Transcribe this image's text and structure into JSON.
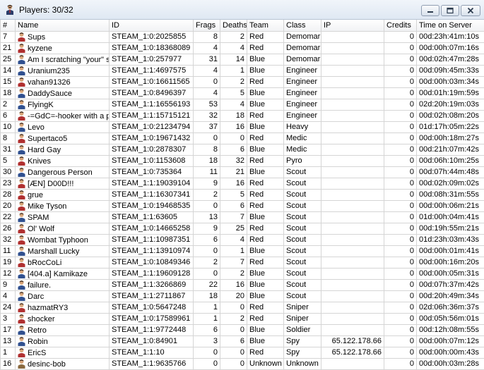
{
  "window": {
    "title": "Players: 30/32"
  },
  "columns": [
    "#",
    "Name",
    "ID",
    "Frags",
    "Deaths",
    "Team",
    "Class",
    "IP",
    "Credits",
    "Time on Server"
  ],
  "rows": [
    {
      "num": "7",
      "name": "Sups",
      "id": "STEAM_1:0:2025855",
      "frags": "8",
      "deaths": "2",
      "team": "Red",
      "class": "Demomar",
      "ip": "",
      "credits": "0",
      "time": "00d:23h:41m:10s"
    },
    {
      "num": "21",
      "name": "kyzene",
      "id": "STEAM_1:0:18368089",
      "frags": "4",
      "deaths": "4",
      "team": "Red",
      "class": "Demomar",
      "ip": "",
      "credits": "0",
      "time": "00d:00h:07m:16s"
    },
    {
      "num": "25",
      "name": "Am I scratching \"your\" s",
      "id": "STEAM_1:0:257977",
      "frags": "31",
      "deaths": "14",
      "team": "Blue",
      "class": "Demomar",
      "ip": "",
      "credits": "0",
      "time": "00d:02h:47m:28s"
    },
    {
      "num": "14",
      "name": "Uranium235",
      "id": "STEAM_1:1:4697575",
      "frags": "4",
      "deaths": "1",
      "team": "Blue",
      "class": "Engineer",
      "ip": "",
      "credits": "0",
      "time": "00d:09h:45m:33s"
    },
    {
      "num": "15",
      "name": "vahan91326",
      "id": "STEAM_1:0:16611565",
      "frags": "0",
      "deaths": "2",
      "team": "Red",
      "class": "Engineer",
      "ip": "",
      "credits": "0",
      "time": "00d:00h:03m:34s"
    },
    {
      "num": "18",
      "name": "DaddySauce",
      "id": "STEAM_1:0:8496397",
      "frags": "4",
      "deaths": "5",
      "team": "Blue",
      "class": "Engineer",
      "ip": "",
      "credits": "0",
      "time": "00d:01h:19m:59s"
    },
    {
      "num": "2",
      "name": "FlyingK",
      "id": "STEAM_1:1:16556193",
      "frags": "53",
      "deaths": "4",
      "team": "Blue",
      "class": "Engineer",
      "ip": "",
      "credits": "0",
      "time": "02d:20h:19m:03s"
    },
    {
      "num": "6",
      "name": "-=GdC=-hooker with a p",
      "id": "STEAM_1:1:15715121",
      "frags": "32",
      "deaths": "18",
      "team": "Red",
      "class": "Engineer",
      "ip": "",
      "credits": "0",
      "time": "00d:02h:08m:20s"
    },
    {
      "num": "10",
      "name": "Levo",
      "id": "STEAM_1:0:21234794",
      "frags": "37",
      "deaths": "16",
      "team": "Blue",
      "class": "Heavy",
      "ip": "",
      "credits": "0",
      "time": "01d:17h:05m:22s"
    },
    {
      "num": "8",
      "name": "Supertaco5",
      "id": "STEAM_1:0:19671432",
      "frags": "0",
      "deaths": "0",
      "team": "Red",
      "class": "Medic",
      "ip": "",
      "credits": "0",
      "time": "00d:00h:18m:27s"
    },
    {
      "num": "31",
      "name": "Hard Gay",
      "id": "STEAM_1:0:2878307",
      "frags": "8",
      "deaths": "6",
      "team": "Blue",
      "class": "Medic",
      "ip": "",
      "credits": "0",
      "time": "00d:21h:07m:42s"
    },
    {
      "num": "5",
      "name": "Knives",
      "id": "STEAM_1:0:1153608",
      "frags": "18",
      "deaths": "32",
      "team": "Red",
      "class": "Pyro",
      "ip": "",
      "credits": "0",
      "time": "00d:06h:10m:25s"
    },
    {
      "num": "30",
      "name": "Dangerous Person",
      "id": "STEAM_1:0:735364",
      "frags": "11",
      "deaths": "21",
      "team": "Blue",
      "class": "Scout",
      "ip": "",
      "credits": "0",
      "time": "00d:07h:44m:48s"
    },
    {
      "num": "23",
      "name": "[ÆN] D00D!!!",
      "id": "STEAM_1:1:19039104",
      "frags": "9",
      "deaths": "16",
      "team": "Red",
      "class": "Scout",
      "ip": "",
      "credits": "0",
      "time": "00d:02h:09m:02s"
    },
    {
      "num": "28",
      "name": "grue",
      "id": "STEAM_1:1:16307341",
      "frags": "2",
      "deaths": "5",
      "team": "Red",
      "class": "Scout",
      "ip": "",
      "credits": "0",
      "time": "00d:08h:31m:55s"
    },
    {
      "num": "20",
      "name": "Mike Tyson",
      "id": "STEAM_1:0:19468535",
      "frags": "0",
      "deaths": "6",
      "team": "Red",
      "class": "Scout",
      "ip": "",
      "credits": "0",
      "time": "00d:00h:06m:21s"
    },
    {
      "num": "22",
      "name": "SPAM",
      "id": "STEAM_1:1:63605",
      "frags": "13",
      "deaths": "7",
      "team": "Blue",
      "class": "Scout",
      "ip": "",
      "credits": "0",
      "time": "01d:00h:04m:41s"
    },
    {
      "num": "26",
      "name": "Ol' Wolf",
      "id": "STEAM_1:0:14665258",
      "frags": "9",
      "deaths": "25",
      "team": "Red",
      "class": "Scout",
      "ip": "",
      "credits": "0",
      "time": "00d:19h:55m:21s"
    },
    {
      "num": "32",
      "name": "Wombat Typhoon",
      "id": "STEAM_1:1:10987351",
      "frags": "6",
      "deaths": "4",
      "team": "Red",
      "class": "Scout",
      "ip": "",
      "credits": "0",
      "time": "01d:23h:03m:43s"
    },
    {
      "num": "11",
      "name": "Marshall Lucky",
      "id": "STEAM_1:1:13910974",
      "frags": "0",
      "deaths": "1",
      "team": "Blue",
      "class": "Scout",
      "ip": "",
      "credits": "0",
      "time": "00d:00h:01m:41s"
    },
    {
      "num": "19",
      "name": "bRocCoLi",
      "id": "STEAM_1:0:10849346",
      "frags": "2",
      "deaths": "7",
      "team": "Red",
      "class": "Scout",
      "ip": "",
      "credits": "0",
      "time": "00d:00h:16m:20s"
    },
    {
      "num": "12",
      "name": "[404.a] Kamikaze",
      "id": "STEAM_1:1:19609128",
      "frags": "0",
      "deaths": "2",
      "team": "Blue",
      "class": "Scout",
      "ip": "",
      "credits": "0",
      "time": "00d:00h:05m:31s"
    },
    {
      "num": "9",
      "name": "failure.",
      "id": "STEAM_1:1:3266869",
      "frags": "22",
      "deaths": "16",
      "team": "Blue",
      "class": "Scout",
      "ip": "",
      "credits": "0",
      "time": "00d:07h:37m:42s"
    },
    {
      "num": "4",
      "name": "Darc",
      "id": "STEAM_1:1:2711867",
      "frags": "18",
      "deaths": "20",
      "team": "Blue",
      "class": "Scout",
      "ip": "",
      "credits": "0",
      "time": "00d:20h:49m:34s"
    },
    {
      "num": "24",
      "name": "hazmatRY3",
      "id": "STEAM_1:0:5647248",
      "frags": "1",
      "deaths": "0",
      "team": "Red",
      "class": "Sniper",
      "ip": "",
      "credits": "0",
      "time": "02d:06h:36m:37s"
    },
    {
      "num": "3",
      "name": "shocker",
      "id": "STEAM_1:0:17589961",
      "frags": "1",
      "deaths": "2",
      "team": "Red",
      "class": "Sniper",
      "ip": "",
      "credits": "0",
      "time": "00d:05h:56m:01s"
    },
    {
      "num": "17",
      "name": "Retro",
      "id": "STEAM_1:1:9772448",
      "frags": "6",
      "deaths": "0",
      "team": "Blue",
      "class": "Soldier",
      "ip": "",
      "credits": "0",
      "time": "00d:12h:08m:55s"
    },
    {
      "num": "13",
      "name": "Robin",
      "id": "STEAM_1:0:84901",
      "frags": "3",
      "deaths": "6",
      "team": "Blue",
      "class": "Spy",
      "ip": "65.122.178.66",
      "credits": "0",
      "time": "00d:00h:07m:12s"
    },
    {
      "num": "1",
      "name": "EricS",
      "id": "STEAM_1:1:10",
      "frags": "0",
      "deaths": "0",
      "team": "Red",
      "class": "Spy",
      "ip": "65.122.178.66",
      "credits": "0",
      "time": "00d:00h:00m:43s"
    },
    {
      "num": "16",
      "name": "desinc-bob",
      "id": "STEAM_1:1:9635766",
      "frags": "0",
      "deaths": "0",
      "team": "Unknown",
      "class": "Unknown",
      "ip": "",
      "credits": "0",
      "time": "00d:00h:03m:28s"
    }
  ]
}
